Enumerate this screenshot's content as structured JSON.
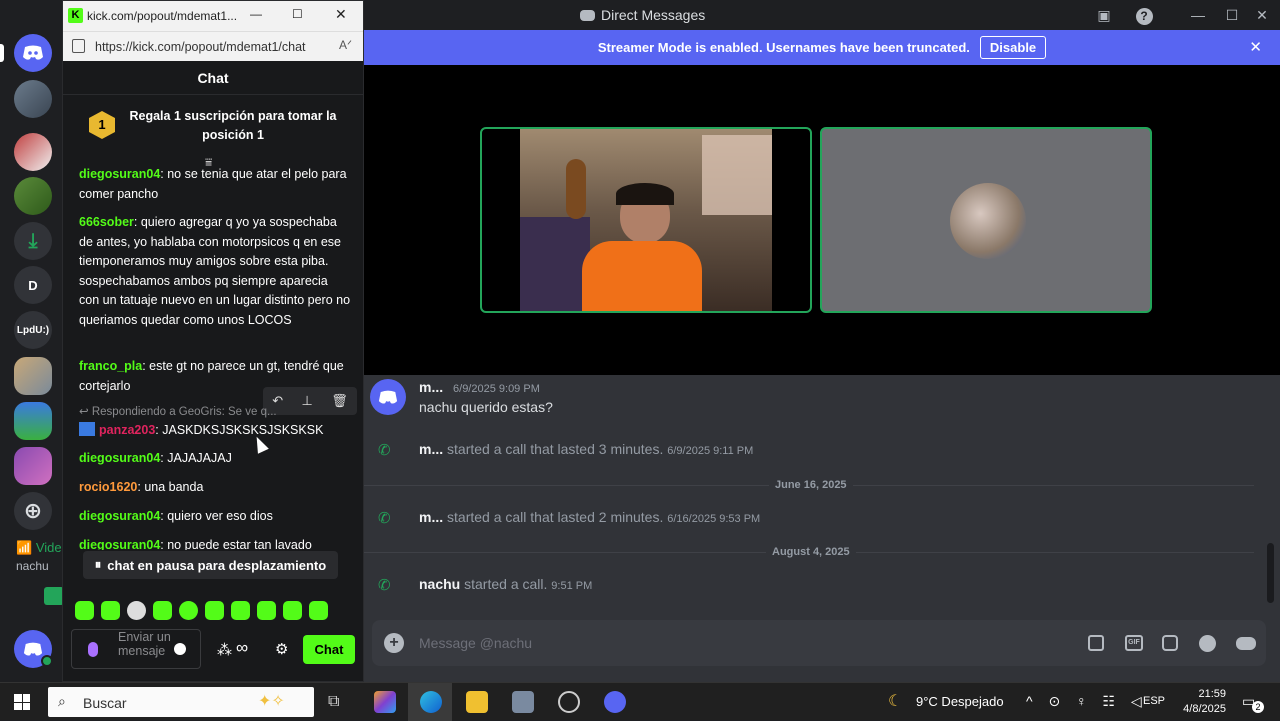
{
  "discord": {
    "window_title": "Direct Messages",
    "banner": {
      "text": "Streamer Mode is enabled. Usernames have been truncated.",
      "button_label": "Disable",
      "close_glyph": "✕"
    },
    "servers": [
      {
        "icon": "discord-home-icon"
      },
      {
        "icon": "server-avatar-icon"
      },
      {
        "icon": "server-avatar-icon"
      },
      {
        "icon": "server-avatar-icon"
      },
      {
        "icon": "download-icon"
      },
      {
        "label": "D"
      },
      {
        "label": "LpdU:)"
      },
      {
        "icon": "server-avatar-icon"
      },
      {
        "icon": "server-avatar-icon"
      },
      {
        "icon": "server-avatar-icon"
      },
      {
        "icon": "add-server-icon"
      }
    ],
    "voice_panel": {
      "label": "Vide",
      "user": "nachu"
    },
    "messages": [
      {
        "author": "m...",
        "timestamp": "6/9/2025 9:09 PM",
        "text": "nachu querido estas?"
      },
      {
        "author": "m...",
        "text": "started a call that lasted 3 minutes.",
        "timestamp": "6/9/2025 9:11 PM"
      },
      {
        "divider": "June 16, 2025"
      },
      {
        "author": "m...",
        "text": "started a call that lasted 2 minutes.",
        "timestamp": "6/16/2025 9:53 PM"
      },
      {
        "divider": "August 4, 2025"
      },
      {
        "author": "nachu",
        "text": "started a call.",
        "timestamp": "9:51 PM"
      }
    ],
    "message_placeholder": "Message @nachu"
  },
  "kick": {
    "tab_title": "kick.com/popout/mdemat1...",
    "url": "https://kick.com/popout/mdemat1/chat",
    "header": "Chat",
    "pinned": {
      "badge": "1",
      "text": "Regala 1 suscripción para tomar la posición 1"
    },
    "messages": [
      {
        "user": "diegosuran04",
        "text": "no se tenia que atar el pelo para comer pancho",
        "color": "#53fc18"
      },
      {
        "user": "666sober",
        "text": "quiero agregar q yo ya sospechaba de antes, yo hablaba con motorpsicos q en ese tiemponeramos muy amigos sobre esta piba. sospechabamos ambos pq siempre aparecia con un tatuaje nuevo en un lugar distinto pero no queriamos quedar como unos LOCOS",
        "color": "#53fc18"
      },
      {
        "user": "franco_pla",
        "text": "este gt no parece un gt, tendré que cortejarlo",
        "color": "#53fc18"
      },
      {
        "reply": "Respondiendo a GeoGris: Se ve q...",
        "user": "panza203",
        "text": "JASKDKSJSKSKSJSKSKSK",
        "color": "#e0245e"
      },
      {
        "user": "diegosuran04",
        "text": "JAJAJAJAJ",
        "color": "#53fc18"
      },
      {
        "user": "rocio1620",
        "text": "una banda",
        "color": "#ff9a3c"
      },
      {
        "user": "diegosuran04",
        "text": "quiero ver eso dios",
        "color": "#53fc18"
      },
      {
        "user": "diegosuran04",
        "text": "no puede estar tan lavado",
        "color": "#53fc18"
      }
    ],
    "pause_text": "chat en pausa para desplazamiento",
    "input_placeholder": "Enviar un mensaje",
    "chat_button": "Chat"
  },
  "taskbar": {
    "search": "Buscar",
    "weather": "9°C  Despejado",
    "lang": "ESP",
    "time": "21:59",
    "date": "4/8/2025",
    "notifications": "2"
  }
}
